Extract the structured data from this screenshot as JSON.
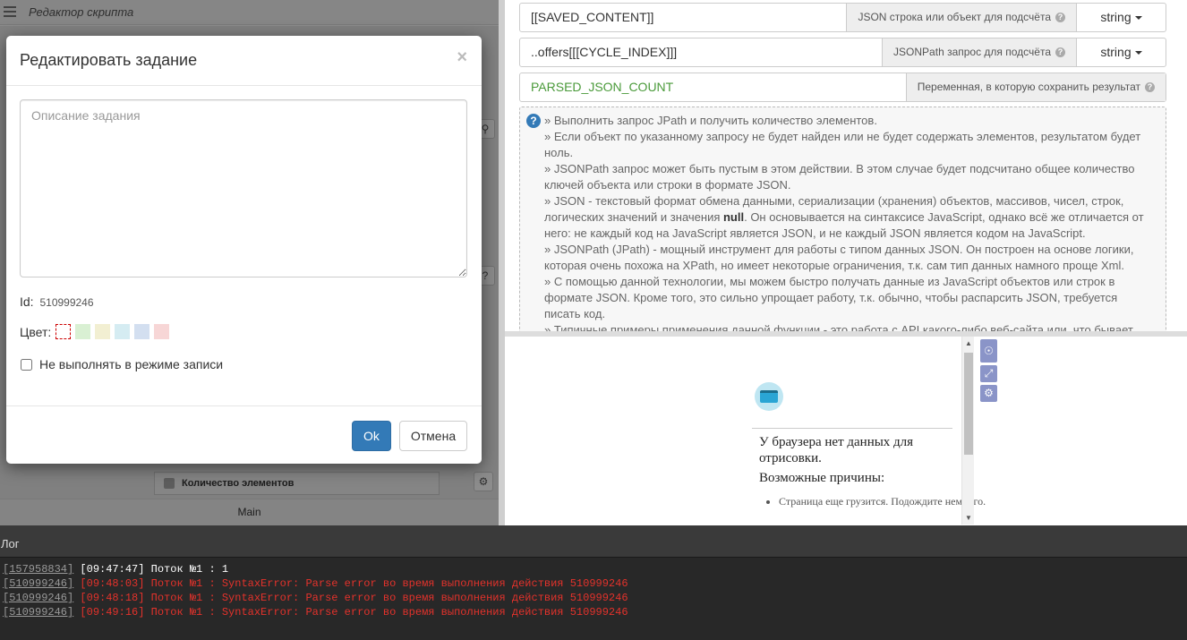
{
  "left": {
    "title": "Редактор скрипта",
    "node_label": "Количество элементов",
    "main_label": "Main"
  },
  "modal": {
    "title": "Редактировать задание",
    "close": "×",
    "description_placeholder": "Описание задания",
    "id_label": "Id:",
    "id_value": "510999246",
    "color_label": "Цвет:",
    "colors": [
      "#ffffff",
      "#d9f0d3",
      "#f2efd2",
      "#d5ecf2",
      "#d3dff0",
      "#f7d6d6"
    ],
    "skip_record_label": "Не выполнять в режиме записи",
    "ok_label": "Ok",
    "cancel_label": "Отмена"
  },
  "props": {
    "row1": {
      "value": "[[SAVED_CONTENT]]",
      "label": "JSON строка или объект для подсчёта",
      "type": "string"
    },
    "row2": {
      "value": "..offers[[[CYCLE_INDEX]]]",
      "label": "JSONPath запрос для подсчёта",
      "type": "string"
    },
    "row3": {
      "value": "PARSED_JSON_COUNT",
      "label": "Переменная, в которую сохранить результат"
    },
    "help_icon": "?"
  },
  "help": {
    "p1": "» Выполнить запрос JPath и получить количество элементов.",
    "p2": "» Если объект по указанному запросу не будет найден или не будет содержать элементов, результатом будет ноль.",
    "p3": "» JSONPath запрос может быть пустым в этом действии. В этом случае будет подсчитано общее количество ключей объекта или строки в формате JSON.",
    "p4a": "» JSON - текстовый формат обмена данными, сериализации (хранения) объектов, массивов, чисел, строк, логических значений и значения ",
    "p4b": "null",
    "p4c": ". Он основывается на синтаксисе JavaScript, однако всё же отличается от него: не каждый код на JavaScript является JSON, и не каждый JSON является кодом на JavaScript.",
    "p5": "» JSONPath (JPath) - мощный инструмент для работы с типом данных JSON. Он построен на основе логики, которая очень похожа на XPath, но имеет некоторые ограничения, т.к. сам тип данных намного проще Xml.",
    "p6": "» С помощью данной технологии, мы можем быстро получать данные из JavaScript объектов или строк в формате JSON. Кроме того, это сильно упрощает работу, т.к. обычно, чтобы распарсить JSON, требуется писать код.",
    "p7": "» Типичные примеры применения данной функции - это работа с API какого-либо веб-сайта или, что бывает"
  },
  "browser": {
    "no_data": "У браузера нет данных для отрисовки.",
    "reasons_title": "Возможные причины:",
    "reason1": "Страница еще грузится. Подождите немного."
  },
  "log": {
    "title": "Лог",
    "lines": [
      {
        "id": "[157958834]",
        "text": " [09:47:47] Поток №1 : 1",
        "level": "ok"
      },
      {
        "id": "[510999246]",
        "text": " [09:48:03] Поток №1 : SyntaxError: Parse error во время выполнения действия 510999246",
        "level": "err"
      },
      {
        "id": "[510999246]",
        "text": " [09:48:18] Поток №1 : SyntaxError: Parse error во время выполнения действия 510999246",
        "level": "err"
      },
      {
        "id": "[510999246]",
        "text": " [09:49:16] Поток №1 : SyntaxError: Parse error во время выполнения действия 510999246",
        "level": "err"
      }
    ]
  }
}
